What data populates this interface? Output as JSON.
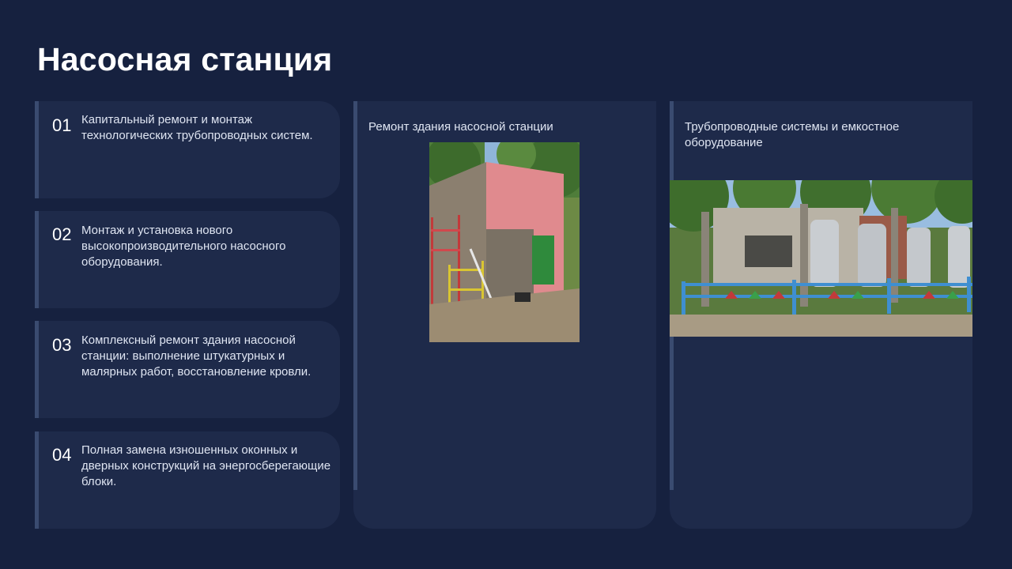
{
  "slide": {
    "title": "Насосная станция"
  },
  "items": [
    {
      "num": "01",
      "text": "Капитальный ремонт и монтаж технологических трубопроводных систем."
    },
    {
      "num": "02",
      "text": "Монтаж и установка нового высокопроизводительного насосного оборудования."
    },
    {
      "num": "03",
      "text": "Комплексный ремонт здания насосной станции: выполнение штукатурных и малярных работ, восстановление кровли."
    },
    {
      "num": "04",
      "text": "Полная замена изношенных оконных и дверных конструкций на энергосберегающие блоки."
    }
  ],
  "panels": [
    {
      "title": "Ремонт здания насосной станции"
    },
    {
      "title": "Трубопроводные системы и емкостное оборудование"
    }
  ],
  "colors": {
    "background": "#16213f",
    "card": "#1e2a4a",
    "accent_bar": "#3a4b70",
    "title": "#ffffff",
    "text": "#dfe5f2"
  }
}
